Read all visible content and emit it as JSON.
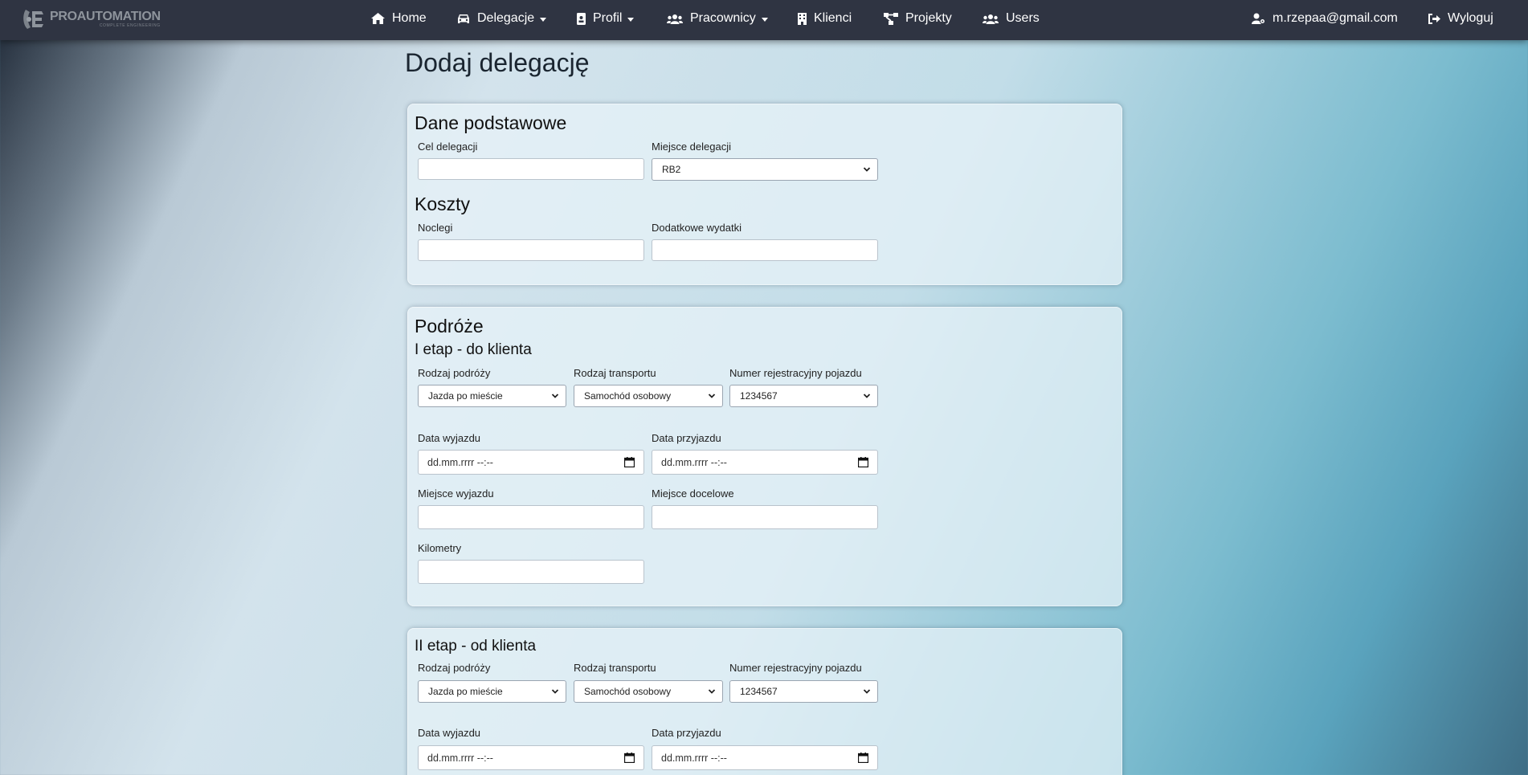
{
  "brand": {
    "name": "PROAUTOMATION",
    "tagline": "COMPLETE ENGINEERING"
  },
  "nav": {
    "home": "Home",
    "delegacje": "Delegacje",
    "profil": "Profil",
    "pracownicy": "Pracownicy",
    "klienci": "Klienci",
    "projekty": "Projekty",
    "users": "Users",
    "user_email": "m.rzepaa@gmail.com",
    "logout": "Wyloguj"
  },
  "page_title": "Dodaj delegację",
  "basic": {
    "heading": "Dane podstawowe",
    "cel_label": "Cel delegacji",
    "cel_value": "",
    "miejsce_label": "Miejsce delegacji",
    "miejsce_value": "RB2"
  },
  "costs": {
    "heading": "Koszty",
    "noclegi_label": "Noclegi",
    "noclegi_value": "",
    "wydatki_label": "Dodatkowe wydatki",
    "wydatki_value": ""
  },
  "travel": {
    "heading": "Podróże",
    "stage1": {
      "heading": "I etap - do klienta",
      "rodzaj_podrozy_label": "Rodzaj podróży",
      "rodzaj_podrozy_value": "Jazda po mieście",
      "rodzaj_transportu_label": "Rodzaj transportu",
      "rodzaj_transportu_value": "Samochód osobowy",
      "numer_label": "Numer rejestracyjny pojazdu",
      "numer_value": "1234567",
      "data_wyjazdu_label": "Data wyjazdu",
      "data_wyjazdu_value": "dd.mm.rrrr --:--",
      "data_przyjazdu_label": "Data przyjazdu",
      "data_przyjazdu_value": "dd.mm.rrrr --:--",
      "miejsce_wyjazdu_label": "Miejsce wyjazdu",
      "miejsce_docelowe_label": "Miejsce docelowe",
      "kilometry_label": "Kilometry"
    },
    "stage2": {
      "heading": "II etap - od klienta",
      "rodzaj_podrozy_label": "Rodzaj podróży",
      "rodzaj_podrozy_value": "Jazda po mieście",
      "rodzaj_transportu_label": "Rodzaj transportu",
      "rodzaj_transportu_value": "Samochód osobowy",
      "numer_label": "Numer rejestracyjny pojazdu",
      "numer_value": "1234567",
      "data_wyjazdu_label": "Data wyjazdu",
      "data_wyjazdu_value": "dd.mm.rrrr --:--",
      "data_przyjazdu_label": "Data przyjazdu",
      "data_przyjazdu_value": "dd.mm.rrrr --:--"
    }
  },
  "colors": {
    "navbar": "#2f3442",
    "text": "#111111",
    "card": "#e8f2f8"
  }
}
